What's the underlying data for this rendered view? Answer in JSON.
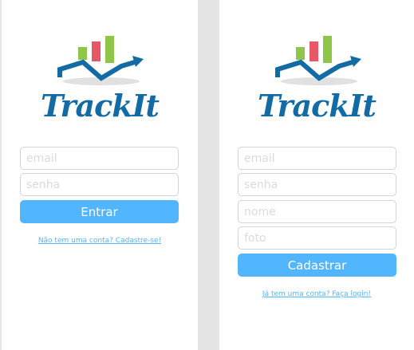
{
  "login": {
    "brand": "TrackIt",
    "email_placeholder": "email",
    "password_placeholder": "senha",
    "submit_label": "Entrar",
    "signup_link": "Não tem uma conta? Cadastre-se!"
  },
  "signup": {
    "brand": "TrackIt",
    "email_placeholder": "email",
    "password_placeholder": "senha",
    "name_placeholder": "nome",
    "photo_placeholder": "foto",
    "submit_label": "Cadastrar",
    "login_link": "Já tem uma conta? Faça login!"
  },
  "colors": {
    "brand_blue": "#126ba5",
    "accent": "#52b6ff",
    "bar_green": "#8fc549",
    "bar_red": "#e75766",
    "logo_shadow": "#e1e1e1"
  }
}
